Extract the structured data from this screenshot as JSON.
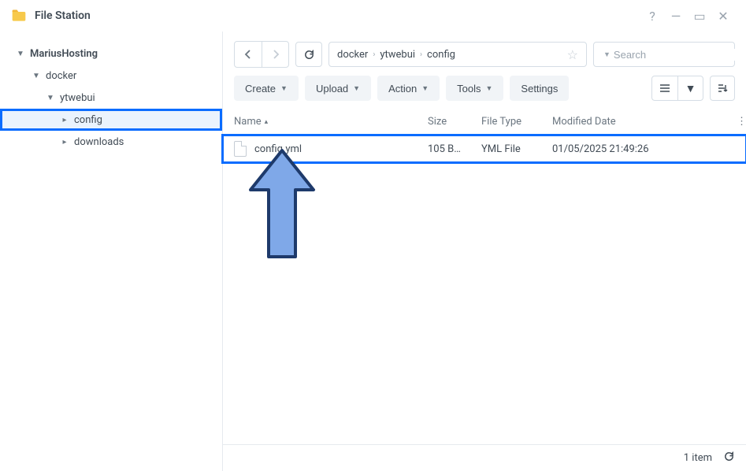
{
  "app": {
    "title": "File Station"
  },
  "tree": {
    "root": "MariusHosting",
    "items": [
      "docker",
      "ytwebui",
      "config",
      "downloads"
    ]
  },
  "breadcrumb": [
    "docker",
    "ytwebui",
    "config"
  ],
  "search": {
    "placeholder": "Search"
  },
  "toolbar": {
    "create": "Create",
    "upload": "Upload",
    "action": "Action",
    "tools": "Tools",
    "settings": "Settings"
  },
  "columns": {
    "name": "Name",
    "size": "Size",
    "type": "File Type",
    "date": "Modified Date"
  },
  "rows": [
    {
      "name": "config.yml",
      "size": "105 B…",
      "type": "YML File",
      "date": "01/05/2025 21:49:26"
    }
  ],
  "status": {
    "count": "1 item"
  }
}
